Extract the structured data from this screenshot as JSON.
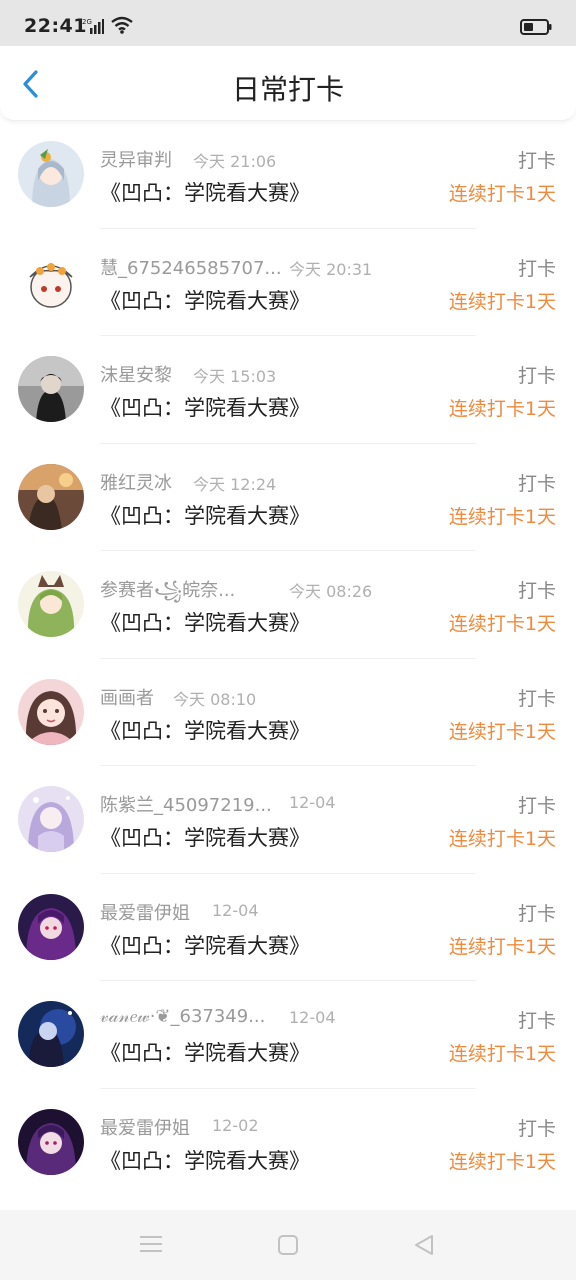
{
  "status_bar": {
    "time": "22:41",
    "network": "2G"
  },
  "header": {
    "title": "日常打卡"
  },
  "list": [
    {
      "name": "灵异审判",
      "time": "今天 21:06",
      "title": "《凹凸：学院看大赛》",
      "status": "打卡",
      "streak": "连续打卡1天"
    },
    {
      "name": "慧_675246585707...",
      "time": "今天 20:31",
      "title": "《凹凸：学院看大赛》",
      "status": "打卡",
      "streak": "连续打卡1天"
    },
    {
      "name": "沫星安黎",
      "time": "今天 15:03",
      "title": "《凹凸：学院看大赛》",
      "status": "打卡",
      "streak": "连续打卡1天"
    },
    {
      "name": "雅红灵冰",
      "time": "今天 12:24",
      "title": "《凹凸：学院看大赛》",
      "status": "打卡",
      "streak": "连续打卡1天"
    },
    {
      "name": "参赛者꧁皖奈...",
      "time": "今天 08:26",
      "title": "《凹凸：学院看大赛》",
      "status": "打卡",
      "streak": "连续打卡1天"
    },
    {
      "name": "画画者",
      "time": "今天 08:10",
      "title": "《凹凸：学院看大赛》",
      "status": "打卡",
      "streak": "连续打卡1天"
    },
    {
      "name": "陈紫兰_45097219...",
      "time": "12-04",
      "title": "《凹凸：学院看大赛》",
      "status": "打卡",
      "streak": "连续打卡1天"
    },
    {
      "name": "最爱雷伊姐",
      "time": "12-04",
      "title": "《凹凸：学院看大赛》",
      "status": "打卡",
      "streak": "连续打卡1天"
    },
    {
      "name": "𝓋𝒶𝓃𝑒𝓌·❦_637349...",
      "time": "12-04",
      "title": "《凹凸：学院看大赛》",
      "status": "打卡",
      "streak": "连续打卡1天"
    },
    {
      "name": "最爱雷伊姐",
      "time": "12-02",
      "title": "《凹凸：学院看大赛》",
      "status": "打卡",
      "streak": "连续打卡1天"
    }
  ],
  "colors": {
    "accent": "#2a8fd8",
    "streak": "#f08a3c"
  }
}
